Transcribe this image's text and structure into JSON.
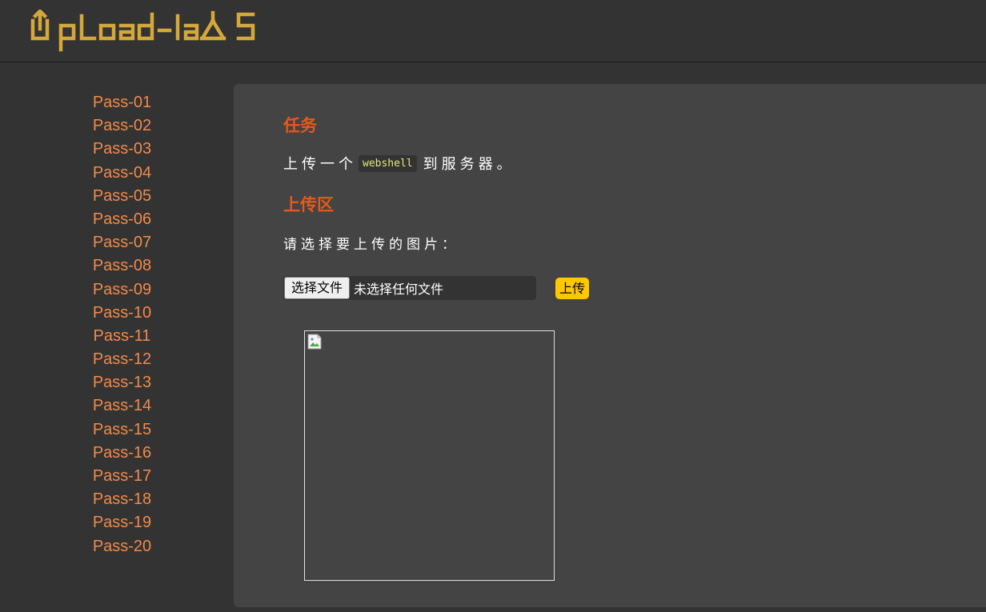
{
  "header": {
    "logo_text": "UpLoad-labs",
    "logo_color": "#d4a83a"
  },
  "sidebar": {
    "items": [
      {
        "label": "Pass-01"
      },
      {
        "label": "Pass-02"
      },
      {
        "label": "Pass-03"
      },
      {
        "label": "Pass-04"
      },
      {
        "label": "Pass-05"
      },
      {
        "label": "Pass-06"
      },
      {
        "label": "Pass-07"
      },
      {
        "label": "Pass-08"
      },
      {
        "label": "Pass-09"
      },
      {
        "label": "Pass-10"
      },
      {
        "label": "Pass-11"
      },
      {
        "label": "Pass-12"
      },
      {
        "label": "Pass-13"
      },
      {
        "label": "Pass-14"
      },
      {
        "label": "Pass-15"
      },
      {
        "label": "Pass-16"
      },
      {
        "label": "Pass-17"
      },
      {
        "label": "Pass-18"
      },
      {
        "label": "Pass-19"
      },
      {
        "label": "Pass-20"
      }
    ],
    "link_color": "#f08a4b"
  },
  "main": {
    "task_heading": "任务",
    "task_prefix": "上传一个",
    "task_code": "webshell",
    "task_suffix": "到服务器。",
    "upload_heading": "上传区",
    "prompt": "请选择要上传的图片：",
    "choose_file_label": "选择文件",
    "file_status": "未选择任何文件",
    "upload_button_label": "上传",
    "preview_icon": "broken-image-icon",
    "heading_color": "#e8581a",
    "accent_color": "#ffc800"
  }
}
